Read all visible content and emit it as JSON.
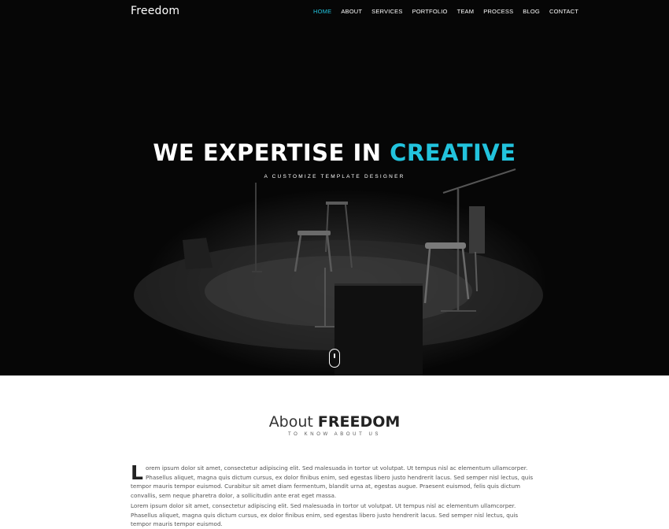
{
  "header": {
    "logo": "Freedom",
    "nav": [
      {
        "label": "HOME",
        "active": true
      },
      {
        "label": "ABOUT",
        "active": false
      },
      {
        "label": "SERVICES",
        "active": false
      },
      {
        "label": "PORTFOLIO",
        "active": false
      },
      {
        "label": "TEAM",
        "active": false
      },
      {
        "label": "PROCESS",
        "active": false
      },
      {
        "label": "BLOG",
        "active": false
      },
      {
        "label": "CONTACT",
        "active": false
      }
    ]
  },
  "hero": {
    "title_main": "WE EXPERTISE IN ",
    "title_accent": "CREATIVE",
    "subtitle": "A CUSTOMIZE TEMPLATE DESIGNER"
  },
  "about": {
    "heading_light": "About ",
    "heading_bold": "FREEDOM",
    "subheading": "TO KNOW ABOUT US",
    "para1_dropcap": "L",
    "para1_text": "orem ipsum dolor sit amet, consectetur adipiscing elit. Sed malesuada in tortor ut volutpat. Ut tempus nisl ac elementum ullamcorper. Phasellus aliquet, magna quis dictum cursus, ex dolor finibus enim, sed egestas libero justo hendrerit lacus. Sed semper nisl lectus, quis tempor mauris tempor euismod. Curabitur sit amet diam fermentum, blandit urna at, egestas augue. Praesent euismod, felis quis dictum convallis, sem neque pharetra dolor, a sollicitudin ante erat eget massa.",
    "para2_text": "Lorem ipsum dolor sit amet, consectetur adipiscing elit. Sed malesuada in tortor ut volutpat. Ut tempus nisl ac elementum ullamcorper. Phasellus aliquet, magna quis dictum cursus, ex dolor finibus enim, sed egestas libero justo hendrerit lacus. Sed semper nisl lectus, quis tempor mauris tempor euismod."
  },
  "colors": {
    "accent": "#22c3dd",
    "hero_bg": "#040404",
    "text_dark": "#222222",
    "text_body": "#555555"
  },
  "icons": {
    "scroll": "mouse-scroll-icon"
  }
}
